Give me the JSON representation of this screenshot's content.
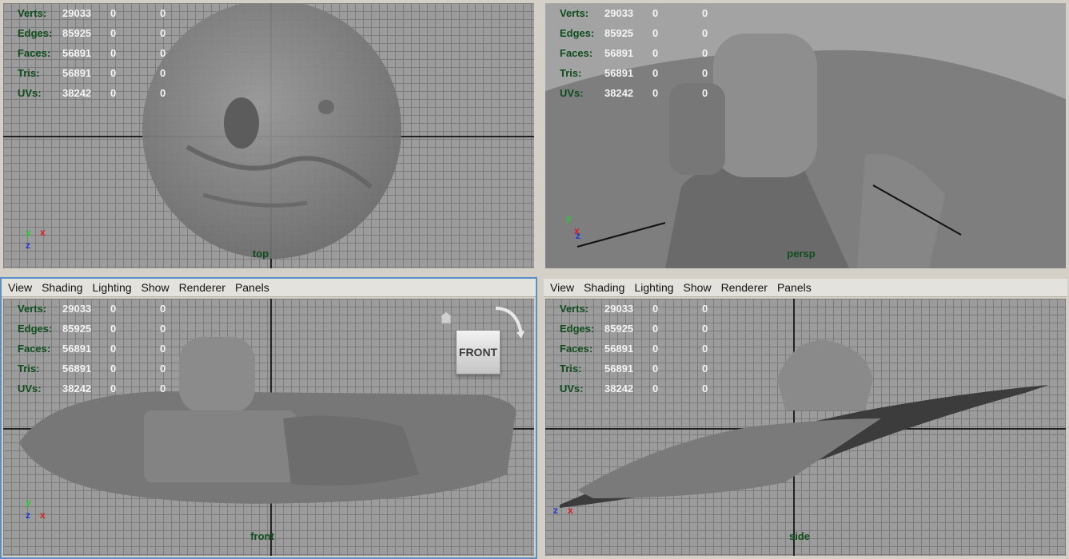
{
  "menu": [
    "View",
    "Shading",
    "Lighting",
    "Show",
    "Renderer",
    "Panels"
  ],
  "hud": [
    {
      "label": "Verts:",
      "value": "29033",
      "a": "0",
      "b": "0"
    },
    {
      "label": "Edges:",
      "value": "85925",
      "a": "0",
      "b": "0"
    },
    {
      "label": "Faces:",
      "value": "56891",
      "a": "0",
      "b": "0"
    },
    {
      "label": "Tris:",
      "value": "56891",
      "a": "0",
      "b": "0"
    },
    {
      "label": "UVs:",
      "value": "38242",
      "a": "0",
      "b": "0"
    }
  ],
  "panels": {
    "top": {
      "camera": "top"
    },
    "persp": {
      "camera": "persp"
    },
    "front": {
      "camera": "front",
      "viewcube": "FRONT"
    },
    "side": {
      "camera": "side"
    }
  },
  "axes": {
    "x": "x",
    "y": "y",
    "z": "z"
  },
  "icons": [
    "home-icon",
    "orbit-arrow-icon"
  ],
  "colors": {
    "viewport": "#9c9c9c",
    "grid": "#7c7c7c",
    "hud_label": "#0f4d1c",
    "hud_value": "#f4f4f4",
    "active_border": "#5a8fc6"
  }
}
